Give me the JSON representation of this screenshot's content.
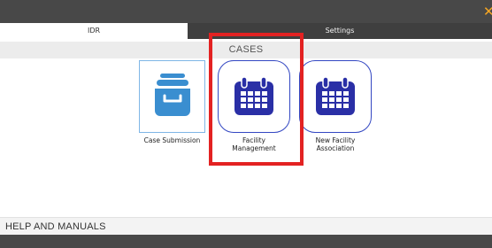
{
  "header": {
    "close_icon": "close-icon",
    "accent": "#f5a623"
  },
  "tabs": [
    {
      "label": "IDR",
      "active": true
    },
    {
      "label": "Settings",
      "active": false
    }
  ],
  "cases": {
    "title": "CASES",
    "tiles": [
      {
        "label": "Case Submission",
        "icon": "file-drawer-icon"
      },
      {
        "label": "Facility\nManagement",
        "icon": "calendar-icon",
        "highlighted": true
      },
      {
        "label": "New Facility\nAssociation",
        "icon": "calendar-icon"
      }
    ]
  },
  "help": {
    "title": "HELP AND MANUALS"
  },
  "colors": {
    "highlight": "#e32222",
    "calendar_blue": "#2a2fa6",
    "drawer_blue": "#3a8ed0",
    "dark_bar": "#484848"
  }
}
